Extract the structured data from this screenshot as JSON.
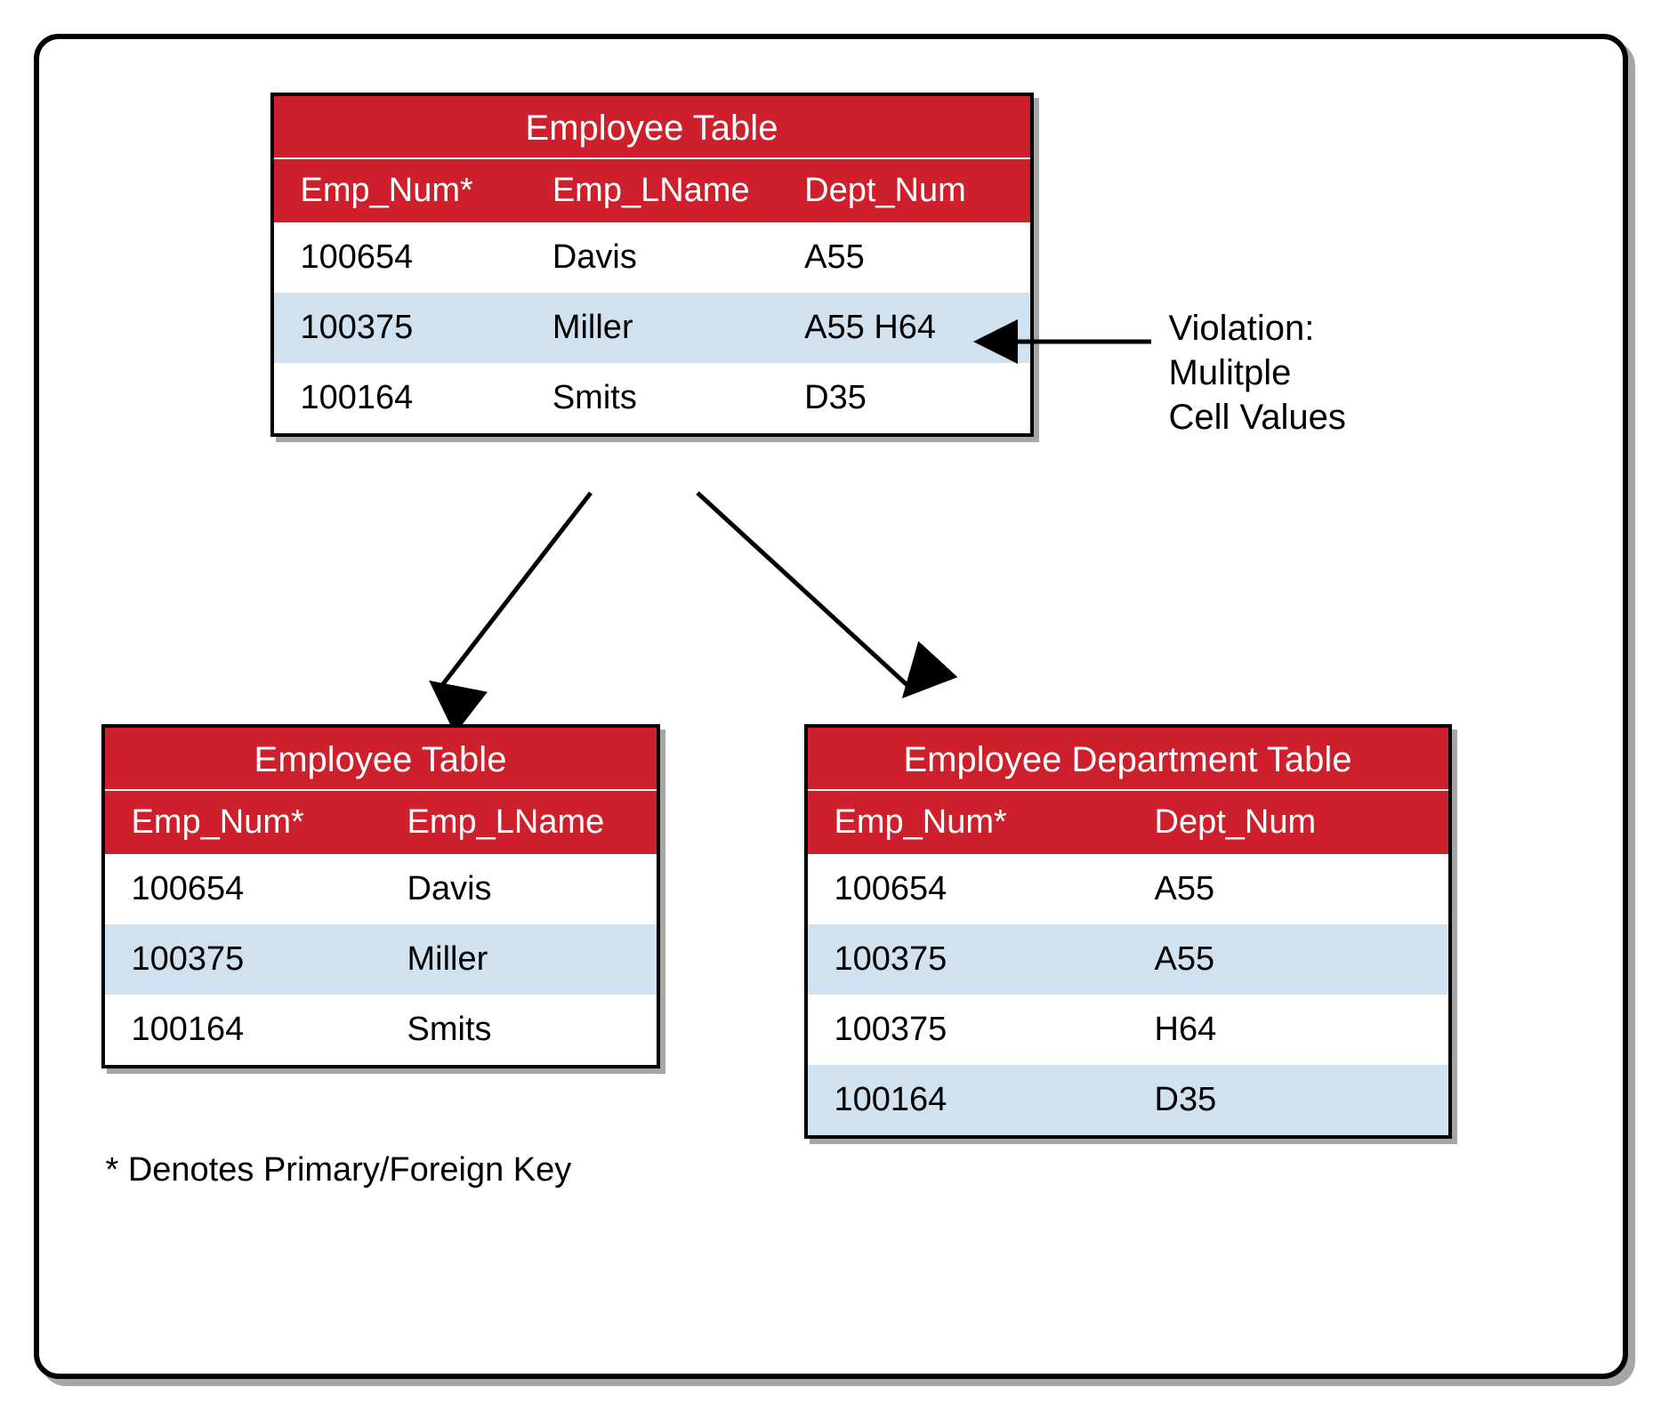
{
  "tables": {
    "top": {
      "title": "Employee Table",
      "cols": [
        "Emp_Num*",
        "Emp_LName",
        "Dept_Num"
      ],
      "rows": [
        [
          "100654",
          "Davis",
          "A55"
        ],
        [
          "100375",
          "Miller",
          "A55 H64"
        ],
        [
          "100164",
          "Smits",
          "D35"
        ]
      ]
    },
    "left": {
      "title": "Employee Table",
      "cols": [
        "Emp_Num*",
        "Emp_LName"
      ],
      "rows": [
        [
          "100654",
          "Davis"
        ],
        [
          "100375",
          "Miller"
        ],
        [
          "100164",
          "Smits"
        ]
      ]
    },
    "right": {
      "title": "Employee Department Table",
      "cols": [
        "Emp_Num*",
        "Dept_Num"
      ],
      "rows": [
        [
          "100654",
          "A55"
        ],
        [
          "100375",
          "A55"
        ],
        [
          "100375",
          "H64"
        ],
        [
          "100164",
          "D35"
        ]
      ]
    }
  },
  "annotation": {
    "line1": "Violation:",
    "line2": "Mulitple",
    "line3": "Cell Values"
  },
  "footnote": "* Denotes Primary/Foreign Key"
}
